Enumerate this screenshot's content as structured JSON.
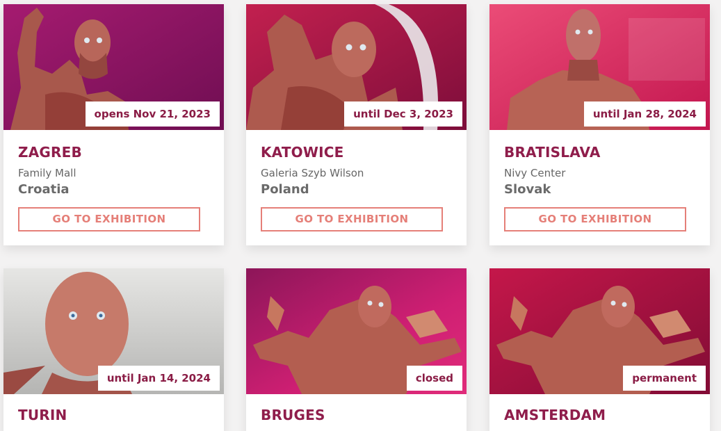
{
  "button_label": "GO TO EXHIBITION",
  "colors": {
    "city": "#8f1d4b",
    "badge_text": "#8a1c45",
    "button": "#e57f78"
  },
  "exhibitions": [
    {
      "city": "ZAGREB",
      "venue": "Family Mall",
      "country": "Croatia",
      "status": "opens Nov 21, 2023",
      "image": "anatomy-figure-raised-arm",
      "bg": [
        "#a01a6a",
        "#7e0f5a"
      ]
    },
    {
      "city": "KATOWICE",
      "venue": "Galeria Szyb Wilson",
      "country": "Poland",
      "status": "until Dec 3, 2023",
      "image": "anatomy-figure-with-hoop",
      "bg": [
        "#b81a55",
        "#8e1040"
      ]
    },
    {
      "city": "BRATISLAVA",
      "venue": "Nivy Center",
      "country": "Slovak",
      "status": "until Jan 28, 2024",
      "image": "anatomy-figure-torso",
      "bg": [
        "#e5426d",
        "#cc1d57"
      ]
    },
    {
      "city": "TURIN",
      "venue": "",
      "country": "",
      "status": "until Jan 14, 2024",
      "image": "anatomy-head-closeup",
      "bg": [
        "#e4e4e2",
        "#b9b9b7"
      ]
    },
    {
      "city": "BRUGES",
      "venue": "",
      "country": "",
      "status": "closed",
      "image": "anatomy-figure-arms-spread",
      "bg": [
        "#cf1f73",
        "#8d1659"
      ]
    },
    {
      "city": "AMSTERDAM",
      "venue": "",
      "country": "",
      "status": "permanent",
      "image": "anatomy-figure-arms-spread",
      "bg": [
        "#b4133e",
        "#8a0d36"
      ]
    }
  ]
}
